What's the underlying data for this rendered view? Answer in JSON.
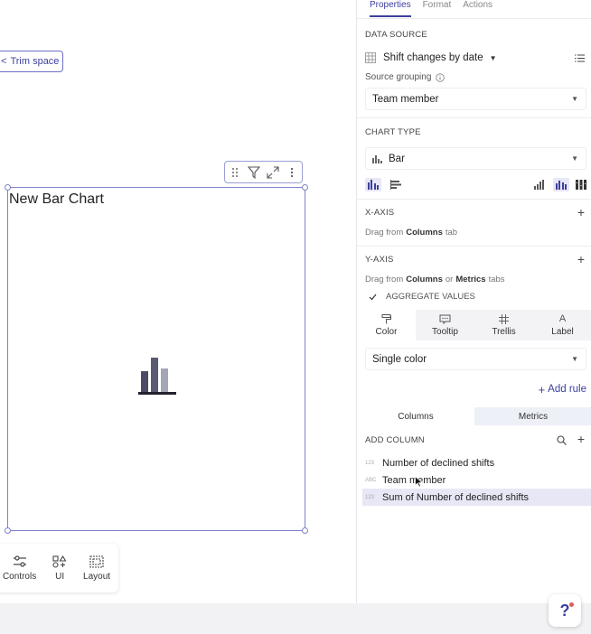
{
  "canvas": {
    "trim_button": "Trim space",
    "chart": {
      "title": "New Bar Chart"
    },
    "bottom_toolbar": {
      "controls": "Controls",
      "ui": "UI",
      "layout": "Layout"
    }
  },
  "panel": {
    "tabs": [
      "Properties",
      "Format",
      "Actions"
    ],
    "data_source": {
      "title": "DATA SOURCE",
      "source_name": "Shift changes by date",
      "grouping_label": "Source grouping",
      "grouping_value": "Team member"
    },
    "chart_type": {
      "title": "CHART TYPE",
      "value": "Bar"
    },
    "x_axis": {
      "title": "X-AXIS",
      "hint_pre": "Drag from ",
      "hint_bold": "Columns",
      "hint_post": " tab"
    },
    "y_axis": {
      "title": "Y-AXIS",
      "hint_pre": "Drag from ",
      "hint_bold1": "Columns",
      "hint_mid": " or ",
      "hint_bold2": "Metrics",
      "hint_post": " tabs",
      "aggregate": "AGGREGATE VALUES"
    },
    "encoding_tabs": [
      "Color",
      "Tooltip",
      "Trellis",
      "Label"
    ],
    "color_mode": "Single color",
    "add_rule": "Add rule",
    "column_tabs": [
      "Columns",
      "Metrics"
    ],
    "add_column": "ADD COLUMN",
    "columns": [
      {
        "type": "123",
        "name": "Number of declined shifts"
      },
      {
        "type": "ABC",
        "name": "Team member"
      },
      {
        "type": "123",
        "name": "Sum of Number of declined shifts"
      }
    ]
  },
  "help": "?",
  "colors": {
    "accent": "#3d3f9e",
    "selection": "#7e83c9",
    "highlight": "#e8e7f6"
  }
}
